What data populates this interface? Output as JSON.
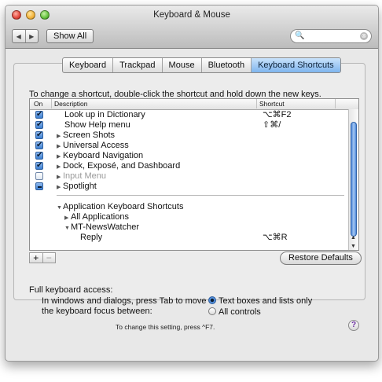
{
  "window": {
    "title": "Keyboard & Mouse"
  },
  "toolbar": {
    "back_icon": "◀",
    "forward_icon": "▶",
    "show_all": "Show All",
    "search_icon": "magnifier-icon",
    "search_value": "",
    "clear_icon": "⊗"
  },
  "tabs": [
    {
      "label": "Keyboard"
    },
    {
      "label": "Trackpad"
    },
    {
      "label": "Mouse"
    },
    {
      "label": "Bluetooth"
    },
    {
      "label": "Keyboard Shortcuts",
      "selected": true
    }
  ],
  "instruction": "To change a shortcut, double-click the shortcut and hold down the new keys.",
  "table": {
    "headers": {
      "on": "On",
      "description": "Description",
      "shortcut": "Shortcut"
    },
    "rows": [
      {
        "check": "checked",
        "indent": 0,
        "disclosure": "",
        "label": "Look up in Dictionary",
        "shortcut": "⌥⌘F2"
      },
      {
        "check": "checked",
        "indent": 0,
        "disclosure": "",
        "label": "Show Help menu",
        "shortcut": "⇧⌘/"
      },
      {
        "check": "checked",
        "indent": 0,
        "disclosure": "▶",
        "label": "Screen Shots",
        "shortcut": ""
      },
      {
        "check": "checked",
        "indent": 0,
        "disclosure": "▶",
        "label": "Universal Access",
        "shortcut": ""
      },
      {
        "check": "checked",
        "indent": 0,
        "disclosure": "▶",
        "label": "Keyboard Navigation",
        "shortcut": ""
      },
      {
        "check": "checked",
        "indent": 0,
        "disclosure": "▶",
        "label": "Dock, Exposé, and Dashboard",
        "shortcut": ""
      },
      {
        "check": "unchecked",
        "indent": 0,
        "disclosure": "▶",
        "label": "Input Menu",
        "shortcut": "",
        "disabled": true
      },
      {
        "check": "mixed",
        "indent": 0,
        "disclosure": "▶",
        "label": "Spotlight",
        "shortcut": ""
      },
      {
        "check": "none",
        "indent": 0,
        "disclosure": "▼",
        "label": "Application Keyboard Shortcuts",
        "shortcut": ""
      },
      {
        "check": "none",
        "indent": 1,
        "disclosure": "▶",
        "label": "All Applications",
        "shortcut": ""
      },
      {
        "check": "none",
        "indent": 1,
        "disclosure": "▼",
        "label": "MT-NewsWatcher",
        "shortcut": ""
      },
      {
        "check": "none",
        "indent": 2,
        "disclosure": "",
        "label": "Reply",
        "shortcut": "⌥⌘R"
      }
    ]
  },
  "buttons": {
    "add": "+",
    "remove": "−",
    "restore_defaults": "Restore Defaults"
  },
  "full_keyboard_access": {
    "heading": "Full keyboard access:",
    "description": "In windows and dialogs, press Tab to move the keyboard focus between:",
    "options": [
      {
        "label": "Text boxes and lists only",
        "selected": true
      },
      {
        "label": "All controls",
        "selected": false
      }
    ],
    "hint": "To change this setting, press ^F7."
  },
  "help": "?",
  "colors": {
    "selected_tab": "#7fb5ee",
    "checkbox": "#3d7fd1",
    "scroll_thumb": "#4d88da"
  }
}
